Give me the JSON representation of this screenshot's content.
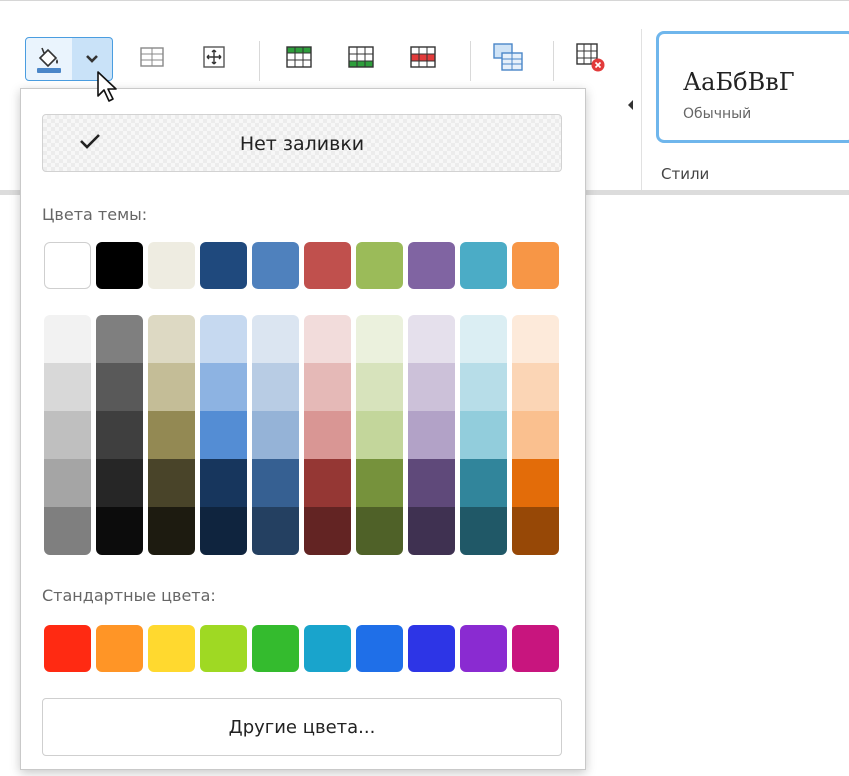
{
  "toolbar": {
    "fill_button_icon": "paint-bucket-icon",
    "fill_arrow_icon": "chevron-down-icon",
    "styles_tile_sample": "АаБбВвГ",
    "styles_tile_name": "Обычный",
    "styles_group_label": "Стили"
  },
  "fill_menu": {
    "no_fill_label": "Нет заливки",
    "no_fill_checked": true,
    "theme_colors_label": "Цвета темы:",
    "theme_colors": [
      "#ffffff",
      "#000000",
      "#eeece1",
      "#1f497d",
      "#4f81bd",
      "#c0504d",
      "#9bbb59",
      "#8064a2",
      "#4bacc6",
      "#f79646"
    ],
    "theme_shades": [
      [
        "#f2f2f2",
        "#d8d8d8",
        "#bfbfbf",
        "#a5a5a5",
        "#7f7f7f"
      ],
      [
        "#7f7f7f",
        "#595959",
        "#3f3f3f",
        "#262626",
        "#0c0c0c"
      ],
      [
        "#ddd9c3",
        "#c4bd97",
        "#938953",
        "#494429",
        "#1d1b10"
      ],
      [
        "#c6d9f0",
        "#8db3e2",
        "#548dd4",
        "#17365d",
        "#0f243e"
      ],
      [
        "#dbe5f1",
        "#b8cce4",
        "#95b3d7",
        "#366092",
        "#244061"
      ],
      [
        "#f2dcdb",
        "#e5b9b7",
        "#d99694",
        "#953734",
        "#632423"
      ],
      [
        "#ebf1dd",
        "#d7e3bc",
        "#c3d69b",
        "#76923c",
        "#4f6128"
      ],
      [
        "#e5e0ec",
        "#ccc1d9",
        "#b2a2c7",
        "#5f497a",
        "#3f3151"
      ],
      [
        "#dbeef3",
        "#b7dde8",
        "#92cddc",
        "#31859b",
        "#205867"
      ],
      [
        "#fdeada",
        "#fbd5b5",
        "#fac08f",
        "#e36c09",
        "#974806"
      ]
    ],
    "standard_colors_label": "Стандартные цвета:",
    "standard_colors": [
      "#ff2a12",
      "#ff9526",
      "#ffd92f",
      "#9fd923",
      "#34bb2e",
      "#19a4cc",
      "#1f6fe8",
      "#2d35e6",
      "#8a2bd1",
      "#c8157e"
    ],
    "more_colors_label": "Другие цвета..."
  }
}
